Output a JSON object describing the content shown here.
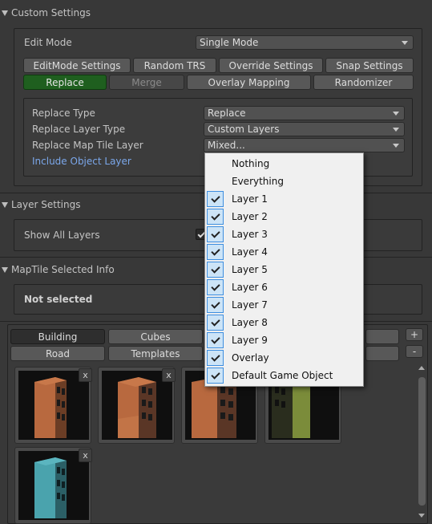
{
  "custom_settings": {
    "title": "Custom Settings",
    "edit_mode_label": "Edit Mode",
    "edit_mode_value": "Single Mode",
    "buttons_row1": [
      "EditMode Settings",
      "Random TRS",
      "Override Settings",
      "Snap Settings"
    ],
    "buttons_row2": [
      "Replace",
      "Merge",
      "Overlay Mapping",
      "Randomizer"
    ],
    "replace_type_label": "Replace Type",
    "replace_type_value": "Replace",
    "replace_layer_type_label": "Replace Layer Type",
    "replace_layer_type_value": "Custom Layers",
    "replace_map_tile_layer_label": "Replace Map Tile Layer",
    "replace_map_tile_layer_value": "Mixed...",
    "include_object_layer_label": "Include Object Layer"
  },
  "layer_settings": {
    "title": "Layer Settings",
    "show_all_layers_label": "Show All Layers",
    "show_all_layers_checked": true
  },
  "map_tile_info": {
    "title": "MapTile Selected Info",
    "status": "Not selected"
  },
  "palette": {
    "tabs_row1": [
      "Building",
      "Cubes"
    ],
    "tabs_row2": [
      "Road",
      "Templates"
    ],
    "add_label": "+",
    "remove_label": "-",
    "tile_close_label": "x"
  },
  "popup": {
    "items": [
      {
        "label": "Nothing",
        "checked": false
      },
      {
        "label": "Everything",
        "checked": false
      },
      {
        "label": "Layer 1",
        "checked": true
      },
      {
        "label": "Layer 2",
        "checked": true
      },
      {
        "label": "Layer 3",
        "checked": true
      },
      {
        "label": "Layer 4",
        "checked": true
      },
      {
        "label": "Layer 5",
        "checked": true
      },
      {
        "label": "Layer 6",
        "checked": true
      },
      {
        "label": "Layer 7",
        "checked": true
      },
      {
        "label": "Layer 8",
        "checked": true
      },
      {
        "label": "Layer 9",
        "checked": true
      },
      {
        "label": "Overlay",
        "checked": true
      },
      {
        "label": "Default Game Object",
        "checked": true
      }
    ]
  },
  "colors": {
    "background": "#383838",
    "active_button": "#1f5f1f",
    "link": "#7ba7ea",
    "popup_bg": "#f0f0f0",
    "check_bg": "#cce4f7"
  }
}
